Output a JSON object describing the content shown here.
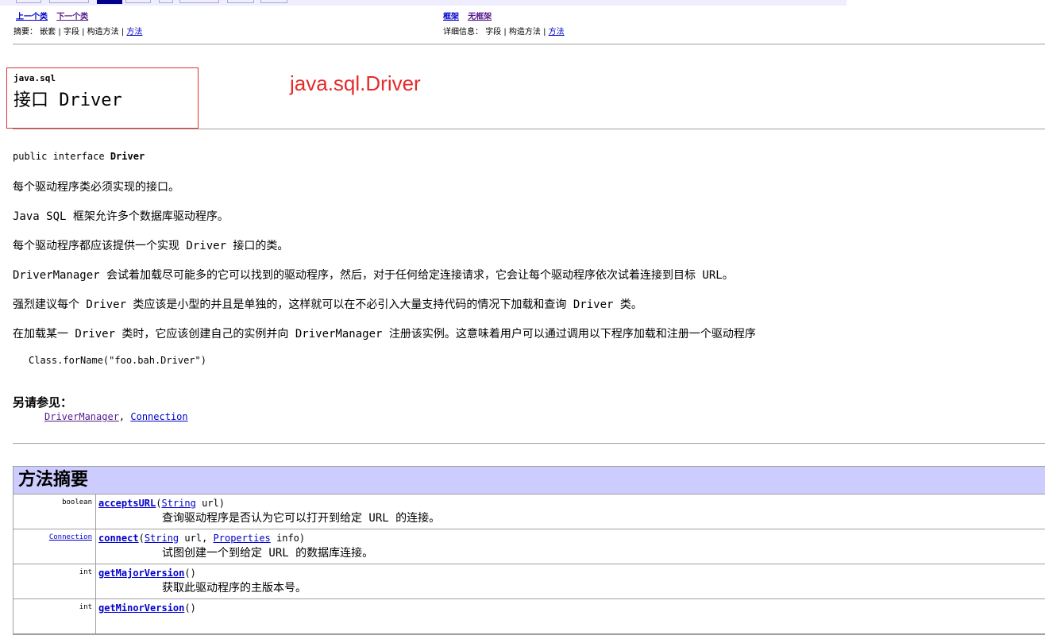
{
  "nav": {
    "prev_class": "上一个类",
    "next_class": "下一个类",
    "frames": "框架",
    "no_frames": "无框架",
    "summary_label": "摘要：",
    "summary_nested": "嵌套",
    "summary_field": "字段",
    "summary_ctor": "构造方法",
    "summary_method": "方法",
    "detail_label": "详细信息：",
    "detail_field": "字段",
    "detail_ctor": "构造方法",
    "detail_method": "方法",
    "sep": " | "
  },
  "header": {
    "package": "java.sql",
    "interface_title": "接口 Driver",
    "annotation": "java.sql.Driver"
  },
  "decl": {
    "prefix": "public interface ",
    "name": "Driver"
  },
  "description": [
    "每个驱动程序类必须实现的接口。",
    "Java SQL 框架允许多个数据库驱动程序。",
    "每个驱动程序都应该提供一个实现 Driver 接口的类。",
    "DriverManager 会试着加载尽可能多的它可以找到的驱动程序，然后，对于任何给定连接请求，它会让每个驱动程序依次试着连接到目标 URL。",
    "强烈建议每个 Driver 类应该是小型的并且是单独的，这样就可以在不必引入大量支持代码的情况下加载和查询 Driver 类。",
    "在加载某一 Driver 类时，它应该创建自己的实例并向 DriverManager 注册该实例。这意味着用户可以通过调用以下程序加载和注册一个驱动程序"
  ],
  "code": "Class.forName(\"foo.bah.Driver\")",
  "see_also": {
    "heading": "另请参见：",
    "link1": "DriverManager",
    "comma": ", ",
    "link2": "Connection"
  },
  "method_summary": {
    "title": "方法摘要",
    "rows": [
      {
        "type": "boolean",
        "name": "acceptsURL",
        "open": "(",
        "p1type": "String",
        "p1name": " url",
        "mid": "",
        "p2type": "",
        "p2name": "",
        "close": ")",
        "desc": "查询驱动程序是否认为它可以打开到给定 URL 的连接。"
      },
      {
        "type": "Connection",
        "name": "connect",
        "open": "(",
        "p1type": "String",
        "p1name": " url, ",
        "mid": "",
        "p2type": "Properties",
        "p2name": " info",
        "close": ")",
        "desc": "试图创建一个到给定 URL 的数据库连接。"
      },
      {
        "type": "int",
        "name": "getMajorVersion",
        "open": "()",
        "p1type": "",
        "p1name": "",
        "mid": "",
        "p2type": "",
        "p2name": "",
        "close": "",
        "desc": "获取此驱动程序的主版本号。"
      },
      {
        "type": "int",
        "name": "getMinorVersion",
        "open": "()",
        "p1type": "",
        "p1name": "",
        "mid": "",
        "p2type": "",
        "p2name": "",
        "close": "",
        "desc": ""
      }
    ]
  }
}
